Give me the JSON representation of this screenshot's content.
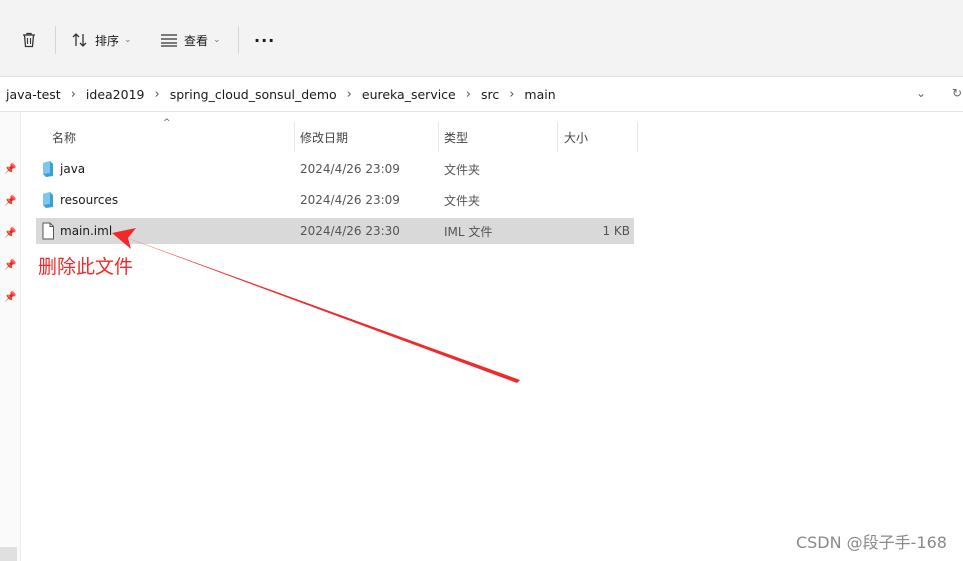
{
  "toolbar": {
    "sort_label": "排序",
    "view_label": "查看",
    "more_label": "···"
  },
  "breadcrumb": [
    "java-test",
    "idea2019",
    "spring_cloud_sonsul_demo",
    "eureka_service",
    "src",
    "main"
  ],
  "columns": {
    "name": "名称",
    "date": "修改日期",
    "type": "类型",
    "size": "大小"
  },
  "rows": [
    {
      "name": "java",
      "date": "2024/4/26 23:09",
      "type": "文件夹",
      "size": "",
      "icon": "folder-icon"
    },
    {
      "name": "resources",
      "date": "2024/4/26 23:09",
      "type": "文件夹",
      "size": "",
      "icon": "folder-icon"
    },
    {
      "name": "main.iml",
      "date": "2024/4/26 23:30",
      "type": "IML 文件",
      "size": "1 KB",
      "icon": "file-icon",
      "selected": true
    }
  ],
  "annotation": {
    "text": "删除此文件",
    "color": "#f02a2a"
  },
  "watermark": "CSDN @段子手-168"
}
